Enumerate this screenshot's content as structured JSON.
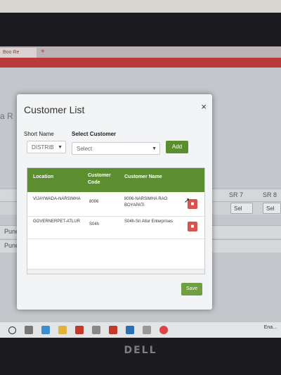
{
  "browser": {
    "tab_label": "Boo Re",
    "new_tab": "+"
  },
  "background_page": {
    "title": "a R",
    "header_cells": [
      "SR 7",
      "SR 8"
    ],
    "row_selects": [
      "Sel",
      "Sel"
    ],
    "row_labels": [
      "Pune",
      "Pune"
    ]
  },
  "modal": {
    "title": "Customer List",
    "close": "×",
    "short_name_label": "Short Name",
    "short_name_value": "DISTRIB",
    "select_customer_label": "Select Customer",
    "select_customer_placeholder": "Select",
    "add_label": "Add",
    "table": {
      "columns": [
        "Location",
        "Customer Code",
        "Customer Name"
      ],
      "rows": [
        {
          "location": "VIJAYWADA-NARSIMHA",
          "code": "8006",
          "name": "8006-NARSIMHA RAO BOYAPATI"
        },
        {
          "location": "GOVERNERPET-ATLUR",
          "code": "S04h",
          "name": "S04h-Sri Atlur Enterprises"
        }
      ]
    },
    "save_label": "Save"
  },
  "taskbar": {
    "tray_text": "Ena..."
  },
  "monitor_brand": "DELL",
  "colors": {
    "accent_green": "#5b8e2e",
    "delete_red": "#d9534f",
    "browser_red": "#b83a3a"
  }
}
